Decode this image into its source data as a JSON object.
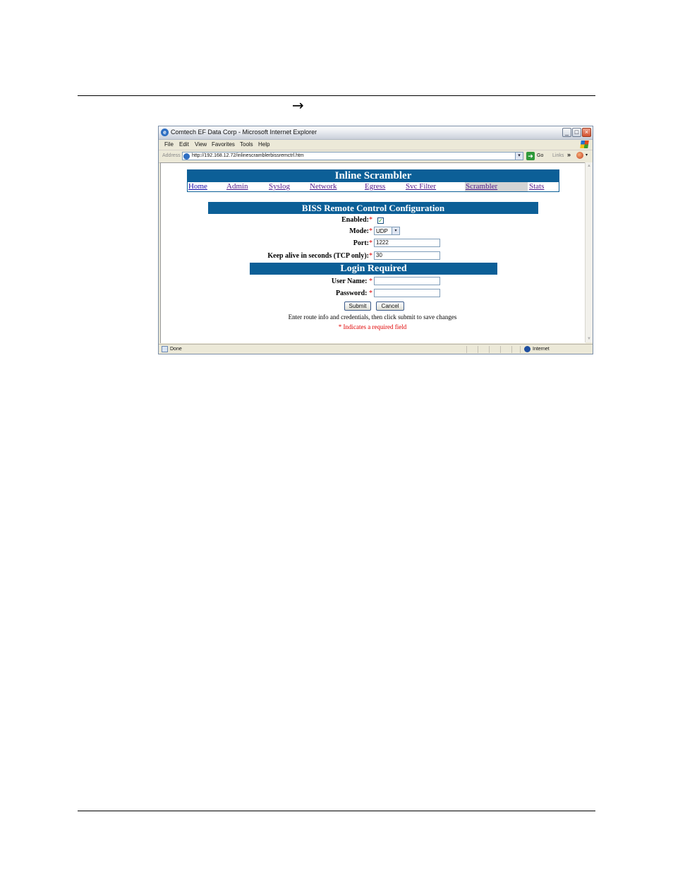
{
  "document": {
    "arrow": "→"
  },
  "window": {
    "title": "Comtech EF Data Corp - Microsoft Internet Explorer",
    "buttons": {
      "minimize": "_",
      "maximize": "□",
      "close": "×"
    }
  },
  "menu": {
    "items": [
      {
        "label": "File"
      },
      {
        "label": "Edit"
      },
      {
        "label": "View"
      },
      {
        "label": "Favorites"
      },
      {
        "label": "Tools"
      },
      {
        "label": "Help"
      }
    ]
  },
  "address_bar": {
    "label": "Address",
    "url": "http://192.168.12.72/inlinescramblerbissremctrl.htm",
    "go_label": "Go",
    "links_label": "Links",
    "chevron": "»"
  },
  "page": {
    "header": "Inline Scrambler",
    "nav": [
      {
        "label": "Home"
      },
      {
        "label": "Admin"
      },
      {
        "label": "Syslog"
      },
      {
        "label": "Network"
      },
      {
        "label": "Egress"
      },
      {
        "label": "Svc Filter"
      },
      {
        "label": "Scrambler"
      },
      {
        "label": "Stats"
      }
    ],
    "nav_active": "Scrambler",
    "section_title": "BISS Remote Control Configuration",
    "fields": {
      "enabled": {
        "label": "Enabled:",
        "checked": true
      },
      "mode": {
        "label": "Mode:",
        "value": "UDP"
      },
      "port": {
        "label": "Port:",
        "value": "1222"
      },
      "keepalive": {
        "label": "Keep alive in seconds (TCP only):",
        "value": "30"
      }
    },
    "login_title": "Login Required",
    "login": {
      "username": {
        "label": "User Name:",
        "value": ""
      },
      "password": {
        "label": "Password:",
        "value": ""
      }
    },
    "required_mark": "*",
    "buttons": {
      "submit": "Submit",
      "cancel": "Cancel"
    },
    "instruction": "Enter route info and credentials, then click submit to save changes",
    "required_note": "* Indicates a required field"
  },
  "status_bar": {
    "status": "Done",
    "zone": "Internet"
  },
  "colors": {
    "header_blue": "#0c5f97",
    "required_red": "#e00000",
    "link_blue": "#1a0dab"
  }
}
